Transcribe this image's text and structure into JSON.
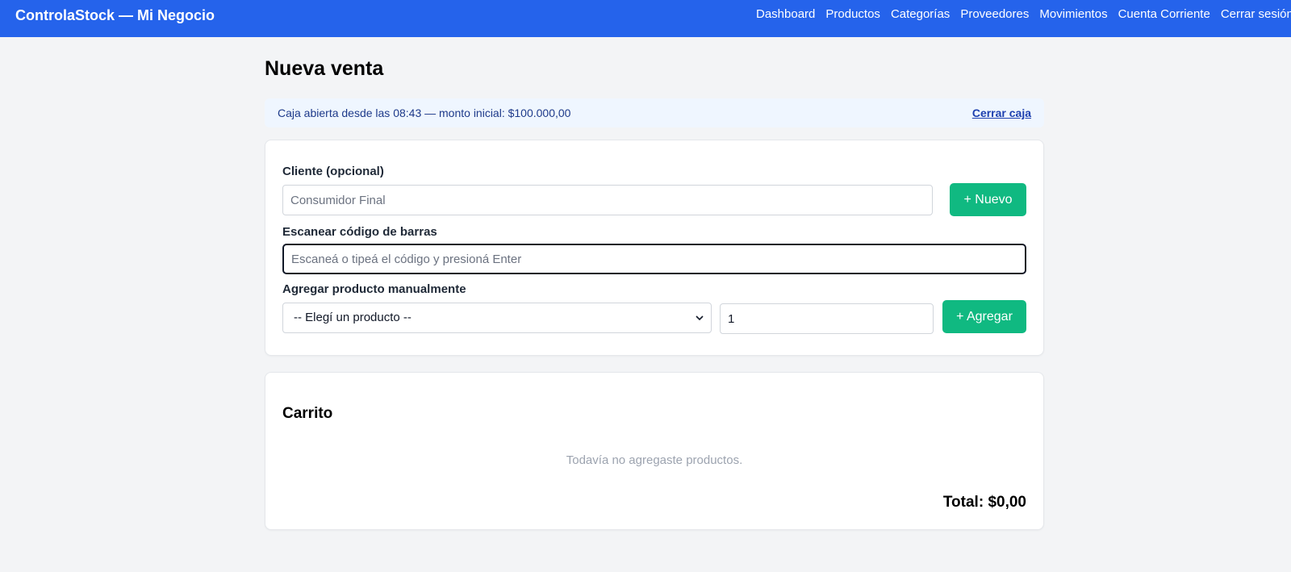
{
  "header": {
    "brand": "ControlaStock",
    "brand_separator": "—",
    "business": "Mi Negocio",
    "nav": [
      "Dashboard",
      "Productos",
      "Categorías",
      "Proveedores",
      "Movimientos",
      "Cuenta Corriente",
      "Cerrar sesión"
    ],
    "color": "#2563eb"
  },
  "page": {
    "title": "Nueva venta"
  },
  "cash": {
    "status": "Caja abierta desde las 08:43 — monto inicial: $100.000,00",
    "close_label": "Cerrar caja"
  },
  "form": {
    "client_label": "Cliente (opcional)",
    "client_placeholder": "Consumidor Final",
    "new_client_button": "+ Nuevo",
    "barcode_label": "Escanear código de barras",
    "barcode_placeholder": "Escaneá o tipeá el código y presioná Enter",
    "manual_label": "Agregar producto manualmente",
    "product_selected": "-- Elegí un producto --",
    "quantity_value": "1",
    "add_button": "+ Agregar",
    "button_color": "#10b981"
  },
  "cart": {
    "title": "Carrito",
    "empty_message": "Todavía no agregaste productos.",
    "total": "Total: $0,00"
  }
}
